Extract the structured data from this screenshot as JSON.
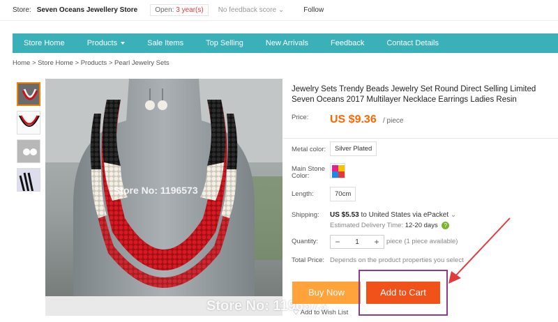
{
  "store_bar": {
    "label": "Store:",
    "store_name": "Seven Oceans Jewellery Store",
    "open_prefix": "Open:",
    "open_years": "3 year(s)",
    "feedback": "No feedback score",
    "follow": "Follow"
  },
  "nav": {
    "items": [
      "Store Home",
      "Products",
      "Sale Items",
      "Top Selling",
      "New Arrivals",
      "Feedback",
      "Contact Details"
    ]
  },
  "breadcrumb": [
    "Home",
    "Store Home",
    "Products",
    "Pearl Jewelry Sets"
  ],
  "watermark": "Store No: 1196573",
  "product": {
    "title": "Jewelry Sets Trendy Beads Jewelry Set Round Direct Selling Limited Seven Oceans 2017 Multilayer Necklace Earrings Ladies Resin",
    "price_label": "Price:",
    "price": "US $9.36",
    "price_unit": "/ piece",
    "metal_label": "Metal color:",
    "metal_value": "Silver Plated",
    "stone_label": "Main Stone Color:",
    "length_label": "Length:",
    "length_value": "70cm",
    "shipping_label": "Shipping:",
    "shipping_cost": "US $5.53",
    "shipping_dest": "to United States via ePacket",
    "delivery_label": "Estimated Delivery Time:",
    "delivery_days": "12-20 days",
    "quantity_label": "Quantity:",
    "quantity_value": "1",
    "quantity_avail": "piece (1 piece available)",
    "total_label": "Total Price:",
    "total_value": "Depends on the product properties you select",
    "buy_now": "Buy Now",
    "add_to_cart": "Add to Cart",
    "wishlist": "Add to Wish List"
  },
  "colors": {
    "nav_bg": "#3ab0b9",
    "price": "#ff6600",
    "buy_now": "#ffa33a",
    "add_to_cart": "#f0521a",
    "annotation": "#8a3c8a"
  }
}
